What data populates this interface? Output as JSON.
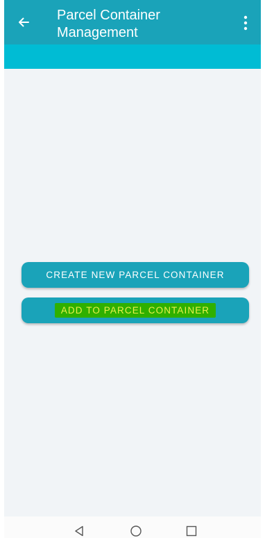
{
  "toolbar": {
    "title": "Parcel Container Management",
    "back_icon": "arrow-left-icon",
    "menu_icon": "more-vert-icon",
    "color": "#1aa3b9"
  },
  "subbar": {
    "color": "#00bcd4"
  },
  "actions": {
    "create_label": "CREATE NEW PARCEL CONTAINER",
    "add_label": "ADD TO PARCEL CONTAINER",
    "button_color": "#1aa3b9",
    "highlight_color": "#2fb000"
  },
  "navbar": {
    "back_icon": "nav-back-triangle-icon",
    "home_icon": "nav-home-circle-icon",
    "recent_icon": "nav-recent-square-icon"
  }
}
